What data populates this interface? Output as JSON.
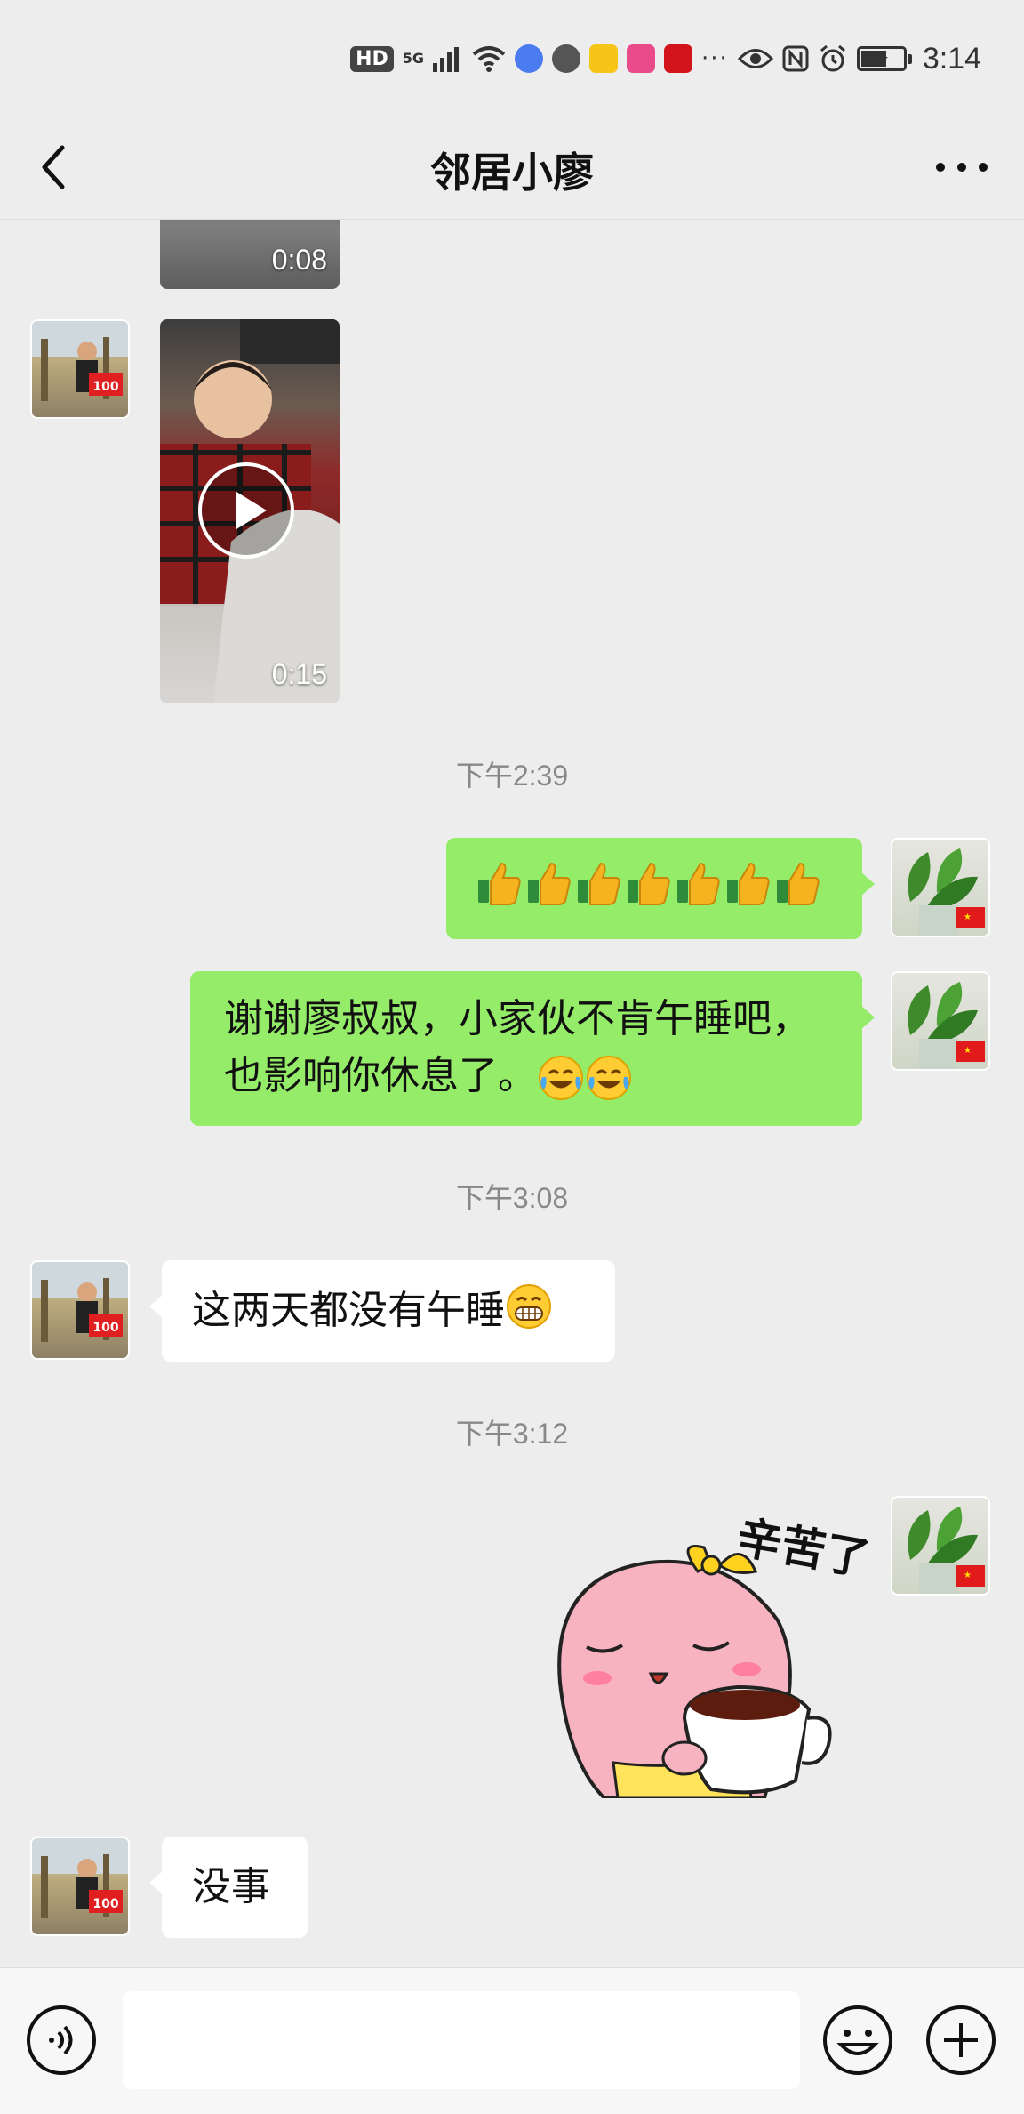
{
  "status_bar": {
    "hd": "HD",
    "network": "5G",
    "time": "3:14"
  },
  "header": {
    "title": "邻居小廖"
  },
  "messages": {
    "video1_duration": "0:08",
    "video2_duration": "0:15",
    "time1": "下午2:39",
    "time2": "下午3:08",
    "time3": "下午3:12",
    "reply1": "谢谢廖叔叔，小家伙不肯午睡吧，",
    "reply2": "也影响你休息了。",
    "incoming1": "这两天都没有午睡",
    "sticker_text": "辛苦了",
    "incoming2": "没事"
  },
  "icons": {
    "back": "back-arrow-icon",
    "more": "more-dots-icon",
    "voice": "voice-icon",
    "emoji": "emoji-icon",
    "plus": "plus-icon",
    "play": "play-icon",
    "thumbs_up": "thumbs-up-emoji",
    "crying_laugh": "tears-of-joy-emoji",
    "grin": "grinning-emoji"
  },
  "colors": {
    "background": "#ededed",
    "bubble_green": "#95ec69",
    "bubble_white": "#ffffff",
    "timestamp": "#888888"
  }
}
